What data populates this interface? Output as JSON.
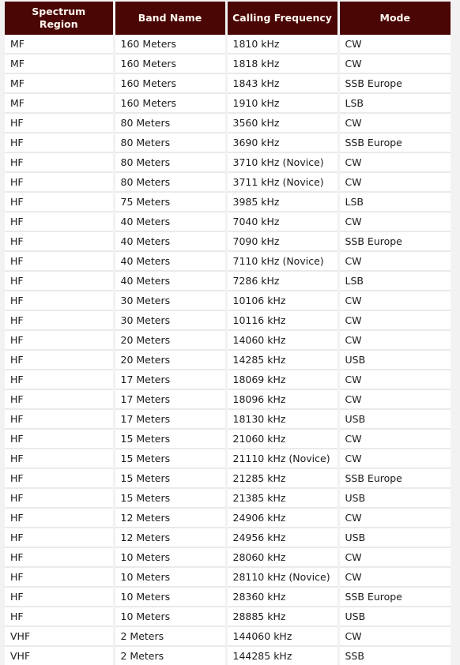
{
  "table": {
    "columns": [
      {
        "label": "Spectrum Region",
        "lines": [
          "Spectrum",
          "Region"
        ],
        "key": "region"
      },
      {
        "label": "Band Name",
        "lines": [
          "Band Name"
        ],
        "key": "band"
      },
      {
        "label": "Calling Frequency",
        "lines": [
          "Calling Frequency"
        ],
        "key": "frequency"
      },
      {
        "label": "Mode",
        "lines": [
          "Mode"
        ],
        "key": "mode"
      }
    ],
    "rows": [
      {
        "region": "MF",
        "band": "160 Meters",
        "frequency": "1810 kHz",
        "mode": "CW"
      },
      {
        "region": "MF",
        "band": "160 Meters",
        "frequency": "1818 kHz",
        "mode": "CW"
      },
      {
        "region": "MF",
        "band": "160 Meters",
        "frequency": "1843 kHz",
        "mode": "SSB Europe"
      },
      {
        "region": "MF",
        "band": "160 Meters",
        "frequency": "1910 kHz",
        "mode": "LSB"
      },
      {
        "region": "HF",
        "band": "80 Meters",
        "frequency": "3560 kHz",
        "mode": "CW"
      },
      {
        "region": "HF",
        "band": "80 Meters",
        "frequency": "3690 kHz",
        "mode": "SSB Europe"
      },
      {
        "region": "HF",
        "band": "80 Meters",
        "frequency": "3710 kHz (Novice)",
        "mode": "CW"
      },
      {
        "region": "HF",
        "band": "80 Meters",
        "frequency": "3711 kHz (Novice)",
        "mode": "CW"
      },
      {
        "region": "HF",
        "band": "75 Meters",
        "frequency": "3985 kHz",
        "mode": "LSB"
      },
      {
        "region": "HF",
        "band": "40 Meters",
        "frequency": "7040 kHz",
        "mode": "CW"
      },
      {
        "region": "HF",
        "band": "40 Meters",
        "frequency": "7090 kHz",
        "mode": "SSB Europe"
      },
      {
        "region": "HF",
        "band": "40 Meters",
        "frequency": "7110 kHz (Novice)",
        "mode": "CW"
      },
      {
        "region": "HF",
        "band": "40 Meters",
        "frequency": "7286 kHz",
        "mode": "LSB"
      },
      {
        "region": "HF",
        "band": "30 Meters",
        "frequency": "10106 kHz",
        "mode": "CW"
      },
      {
        "region": "HF",
        "band": "30 Meters",
        "frequency": "10116 kHz",
        "mode": "CW"
      },
      {
        "region": "HF",
        "band": "20 Meters",
        "frequency": "14060 kHz",
        "mode": "CW"
      },
      {
        "region": "HF",
        "band": "20 Meters",
        "frequency": "14285 kHz",
        "mode": "USB"
      },
      {
        "region": "HF",
        "band": "17 Meters",
        "frequency": "18069 kHz",
        "mode": "CW"
      },
      {
        "region": "HF",
        "band": "17 Meters",
        "frequency": "18096 kHz",
        "mode": "CW"
      },
      {
        "region": "HF",
        "band": "17 Meters",
        "frequency": "18130 kHz",
        "mode": "USB"
      },
      {
        "region": "HF",
        "band": "15 Meters",
        "frequency": "21060 kHz",
        "mode": "CW"
      },
      {
        "region": "HF",
        "band": "15 Meters",
        "frequency": "21110 kHz (Novice)",
        "mode": "CW"
      },
      {
        "region": "HF",
        "band": "15 Meters",
        "frequency": "21285 kHz",
        "mode": "SSB Europe"
      },
      {
        "region": "HF",
        "band": "15 Meters",
        "frequency": "21385 kHz",
        "mode": "USB"
      },
      {
        "region": "HF",
        "band": "12 Meters",
        "frequency": "24906 kHz",
        "mode": "CW"
      },
      {
        "region": "HF",
        "band": "12 Meters",
        "frequency": "24956 kHz",
        "mode": "USB"
      },
      {
        "region": "HF",
        "band": "10 Meters",
        "frequency": "28060 kHz",
        "mode": "CW"
      },
      {
        "region": "HF",
        "band": "10 Meters",
        "frequency": "28110 kHz (Novice)",
        "mode": "CW"
      },
      {
        "region": "HF",
        "band": "10 Meters",
        "frequency": "28360 kHz",
        "mode": "SSB Europe"
      },
      {
        "region": "HF",
        "band": "10 Meters",
        "frequency": "28885 kHz",
        "mode": "USB"
      },
      {
        "region": "VHF",
        "band": "2 Meters",
        "frequency": "144060 kHz",
        "mode": "CW"
      },
      {
        "region": "VHF",
        "band": "2 Meters",
        "frequency": "144285 kHz",
        "mode": "SSB"
      }
    ]
  },
  "colors": {
    "header_background": "#4a0505",
    "header_text": "#fdf6ee",
    "page_background": "#f2f2f2",
    "cell_background": "#ffffff",
    "cell_text": "#1b1b1b",
    "row_divider": "#eaeaea"
  }
}
